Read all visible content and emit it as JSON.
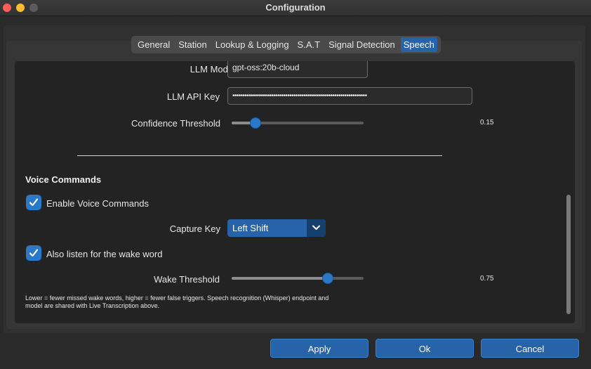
{
  "window": {
    "title": "Configuration"
  },
  "tabs": [
    {
      "label": "General"
    },
    {
      "label": "Station"
    },
    {
      "label": "Lookup & Logging"
    },
    {
      "label": "S.A.T"
    },
    {
      "label": "Signal Detection"
    },
    {
      "label": "Speech",
      "active": true
    }
  ],
  "llm": {
    "model_label": "LLM Model",
    "model_value": "gpt-oss:20b-cloud",
    "api_key_label": "LLM API Key",
    "api_key_value": "••••••••••••••••••••••••••••••••••••••••••••••••••••••••••••••••••",
    "confidence_label": "Confidence Threshold",
    "confidence_value": "0.15",
    "confidence_fraction": 0.15
  },
  "voice": {
    "section_title": "Voice Commands",
    "enable_label": "Enable Voice Commands",
    "enable_checked": true,
    "capture_key_label": "Capture Key",
    "capture_key_value": "Left Shift",
    "wake_word_label": "Also listen for the wake word",
    "wake_word_checked": true,
    "wake_threshold_label": "Wake Threshold",
    "wake_threshold_value": "0.75",
    "wake_threshold_fraction": 0.75,
    "help_text": "Lower = fewer missed wake words, higher = fewer false triggers. Speech recognition (Whisper) endpoint and model are shared with Live Transcription above."
  },
  "buttons": {
    "apply": "Apply",
    "ok": "Ok",
    "cancel": "Cancel"
  },
  "colors": {
    "accent": "#2763a8",
    "knob": "#2a78c8",
    "background": "#232323"
  },
  "icons": {
    "checkbox": "checkmark-icon",
    "combo": "chevron-down-icon"
  }
}
